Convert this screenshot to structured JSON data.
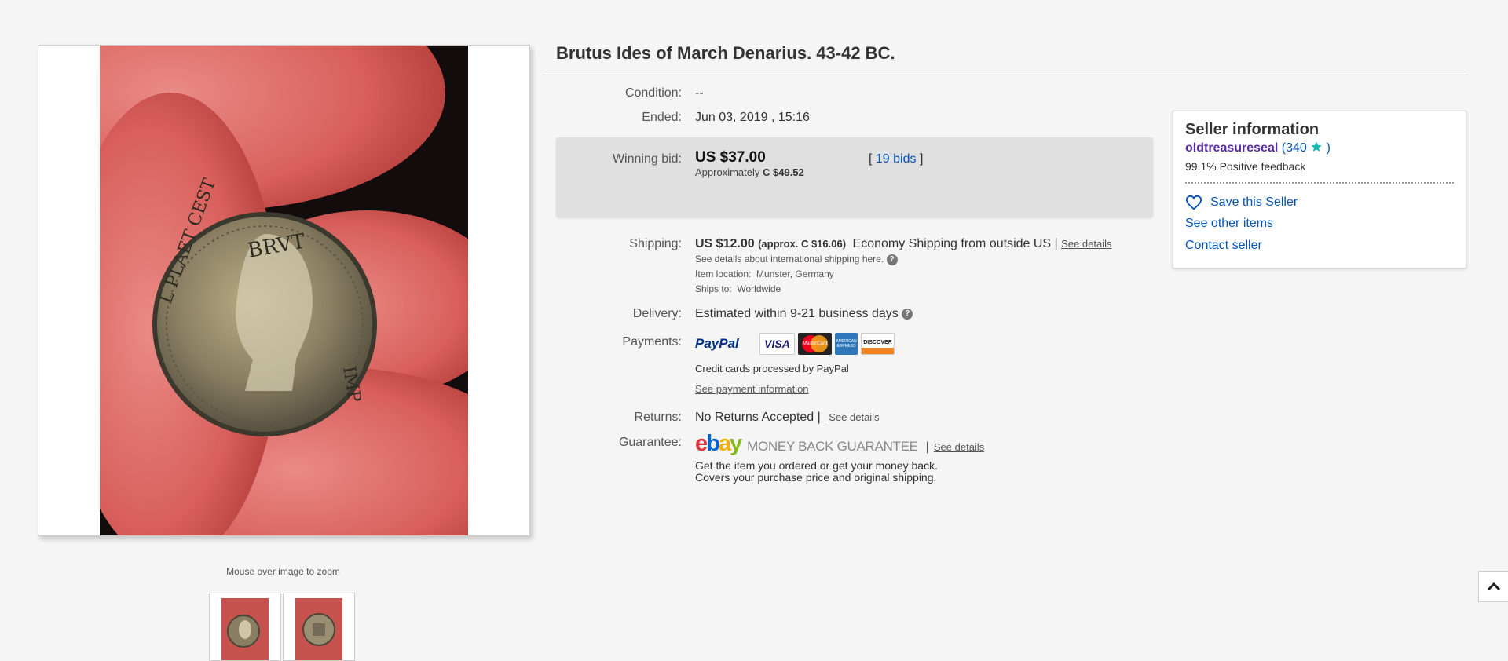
{
  "item": {
    "title": "Brutus Ides of March Denarius. 43-42 BC."
  },
  "gallery": {
    "zoom_hint": "Mouse over image to zoom",
    "main_alt": "coin-photo"
  },
  "details": {
    "condition_label": "Condition:",
    "condition_value": "--",
    "ended_label": "Ended:",
    "ended_value": "Jun 03, 2019 , 15:16",
    "winning_label": "Winning bid:",
    "winning_price": "US $37.00",
    "approx_prefix": "Approximately",
    "approx_value": "C $49.52",
    "bids_open": "[",
    "bids_text": "19 bids",
    "bids_close": "]",
    "shipping_label": "Shipping:",
    "shipping_price": "US $12.00",
    "shipping_approx": "(approx. C $16.06)",
    "shipping_method": "Economy Shipping from outside US |",
    "shipping_details": "See details",
    "intl_note": "See details about international shipping here.",
    "location_label": "Item location:",
    "location_value": "Munster, Germany",
    "ships_label": "Ships to:",
    "ships_value": "Worldwide",
    "delivery_label": "Delivery:",
    "delivery_value": "Estimated within 9-21 business days",
    "payments_label": "Payments:",
    "paypal": "PayPal",
    "visa": "VISA",
    "mastercard": "MasterCard",
    "amex": "AMERICAN EXPRESS",
    "discover": "DISCOVER",
    "cc_note": "Credit cards processed by PayPal",
    "payment_info": "See payment information",
    "returns_label": "Returns:",
    "returns_value": "No Returns Accepted |",
    "returns_details": "See details",
    "guarantee_label": "Guarantee:",
    "mbg_text": "MONEY BACK GUARANTEE",
    "guarantee_sep": "|",
    "guarantee_details": "See details",
    "guarantee_line1": "Get the item you ordered or get your money back.",
    "guarantee_line2": "Covers your purchase price and original shipping."
  },
  "seller": {
    "heading": "Seller information",
    "username": "oldtreasureseal",
    "score_open": "(",
    "score": "340",
    "score_close": ")",
    "feedback": "99.1% Positive feedback",
    "save": "Save this Seller",
    "other_items": "See other items",
    "contact": "Contact seller"
  },
  "icons": {
    "star": "star-icon",
    "heart": "heart-icon",
    "help": "help-icon",
    "chevron_up": "chevron-up-icon"
  },
  "colors": {
    "link": "#0654ba",
    "seller_name": "#5a2d9e",
    "star": "#1fb8b4",
    "bid_panel": "#e0e0e0"
  }
}
